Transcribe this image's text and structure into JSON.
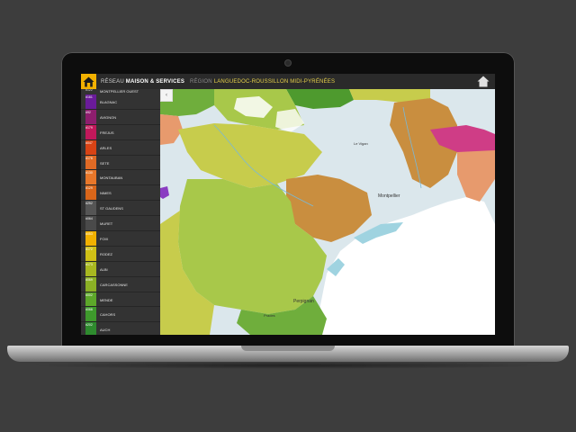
{
  "header": {
    "reseau_prefix": "RÉSEAU",
    "brand_name": "MAISON & SERVICES",
    "region_prefix": "RÉGION",
    "region_name": "LANGUEDOC-ROUSSILLON MIDI-PYRÉNÉES"
  },
  "sidebar": {
    "top_item": {
      "code": "#122",
      "label": "MONTPELLIER OUEST"
    },
    "items": [
      {
        "code": "#161",
        "label": "BLAGNAC",
        "color": "#6a1b9a"
      },
      {
        "code": "#92",
        "label": "AVIGNON",
        "color": "#8e1e6e"
      },
      {
        "code": "#179",
        "label": "FREJUS",
        "color": "#c2185b"
      },
      {
        "code": "#047",
        "label": "ARLES",
        "color": "#d84315"
      },
      {
        "code": "#178",
        "label": "SETE",
        "color": "#e06a25"
      },
      {
        "code": "#130",
        "label": "MONTAUBAN",
        "color": "#e8772a"
      },
      {
        "code": "#129",
        "label": "NIMES",
        "color": "#d9661a"
      },
      {
        "code": "#252",
        "label": "ST GAUDENS",
        "color": "#555555"
      },
      {
        "code": "#064",
        "label": "MURET",
        "color": "#4a4a4a"
      },
      {
        "code": "#053",
        "label": "FOIX",
        "color": "#f2b100"
      },
      {
        "code": "#172",
        "label": "RODEZ",
        "color": "#cfc016"
      },
      {
        "code": "#173",
        "label": "ALBI",
        "color": "#a8b820"
      },
      {
        "code": "#069",
        "label": "CARCASSONNE",
        "color": "#8bb025"
      },
      {
        "code": "#002",
        "label": "MENDE",
        "color": "#5da82a"
      },
      {
        "code": "#068",
        "label": "CAHORS",
        "color": "#3e9a2c"
      },
      {
        "code": "#202",
        "label": "AUCH",
        "color": "#2e8b2e"
      }
    ]
  },
  "map": {
    "labels": {
      "montpellier": "Montpellier",
      "perpignan": "Perpignan",
      "le_vigan": "Le Vigan",
      "prades": "Prades"
    },
    "colors": {
      "sea": "#ffffff",
      "water": "#9fd3e0",
      "green_dark": "#6fae3c",
      "green_light": "#a8c84a",
      "yellow_green": "#c7cc4c",
      "orange_brown": "#c98e3f",
      "salmon": "#e79a6d",
      "magenta": "#cf3d86",
      "light_gray": "#dbe7ec",
      "purple": "#8a3cc2"
    }
  },
  "home_icon_name": "home-icon",
  "collapse_icon_name": "chevron-left-icon"
}
